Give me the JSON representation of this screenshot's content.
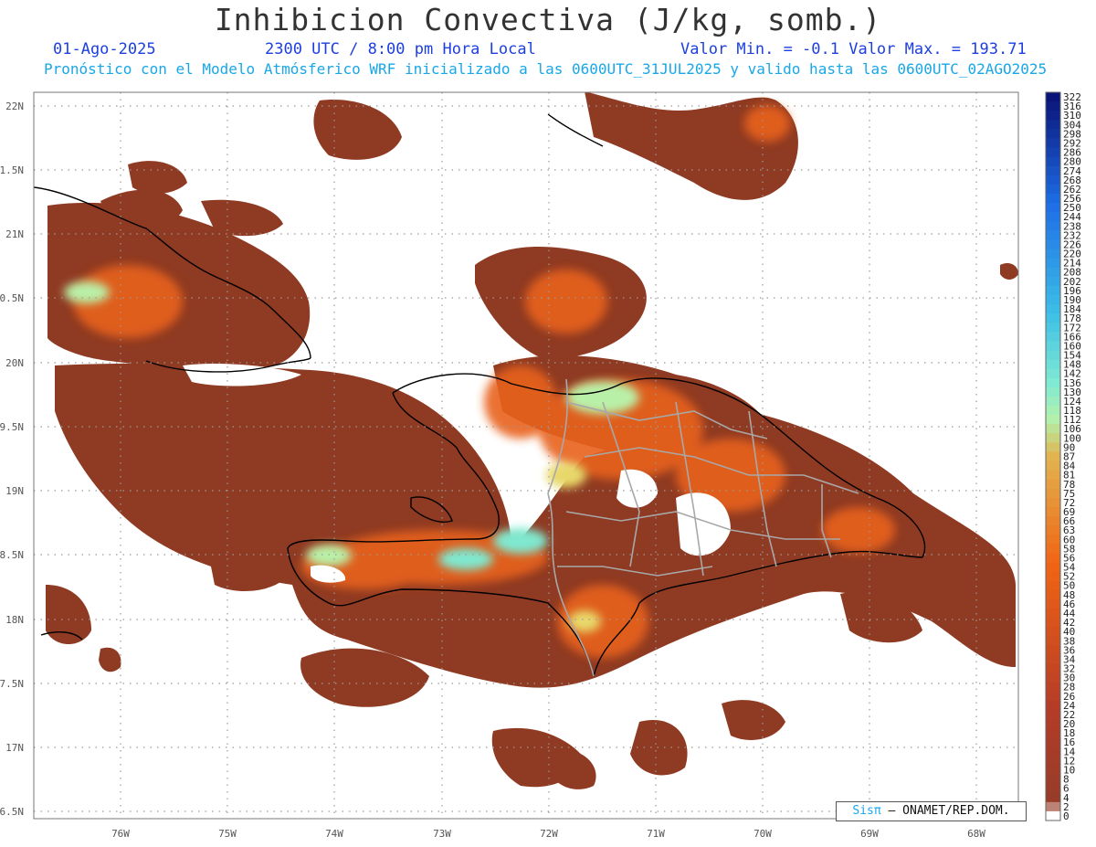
{
  "title": "Inhibicion Convectiva (J/kg, somb.)",
  "date": "01-Ago-2025",
  "time": "2300 UTC / 8:00 pm Hora Local",
  "stats": "Valor Min. = -0.1  Valor Max. = 193.71",
  "subtitle": "Pronóstico con el Modelo Atmósferico WRF inicializado a las 0600UTC_31JUL2025 y valido hasta las  0600UTC_02AGO2025",
  "lat_labels": [
    "22N",
    "1.5N",
    "21N",
    "0.5N",
    "20N",
    "9.5N",
    "19N",
    "8.5N",
    "18N",
    "7.5N",
    "17N",
    "6.5N"
  ],
  "lon_labels": [
    "76W",
    "75W",
    "74W",
    "73W",
    "72W",
    "71W",
    "70W",
    "69W",
    "68W"
  ],
  "colorbar_labels": [
    "322",
    "316",
    "310",
    "304",
    "298",
    "292",
    "286",
    "280",
    "274",
    "268",
    "262",
    "256",
    "250",
    "244",
    "238",
    "232",
    "226",
    "220",
    "214",
    "208",
    "202",
    "196",
    "190",
    "184",
    "178",
    "172",
    "166",
    "160",
    "154",
    "148",
    "142",
    "136",
    "130",
    "124",
    "118",
    "112",
    "106",
    "100",
    "90",
    "87",
    "84",
    "81",
    "78",
    "75",
    "72",
    "69",
    "66",
    "63",
    "60",
    "58",
    "56",
    "54",
    "52",
    "50",
    "48",
    "46",
    "44",
    "42",
    "40",
    "38",
    "36",
    "34",
    "32",
    "30",
    "28",
    "26",
    "24",
    "22",
    "20",
    "18",
    "16",
    "14",
    "12",
    "10",
    "8",
    "6",
    "4",
    "2",
    "0"
  ],
  "credit": {
    "sis": "Sisπ",
    "org": " – ONAMET/REP.DOM."
  },
  "colors": {
    "field": "#8f3a22",
    "warm": "#e8621f",
    "cool": "#7fe8cf",
    "coast": "#000000",
    "border": "#a0a0a0"
  }
}
